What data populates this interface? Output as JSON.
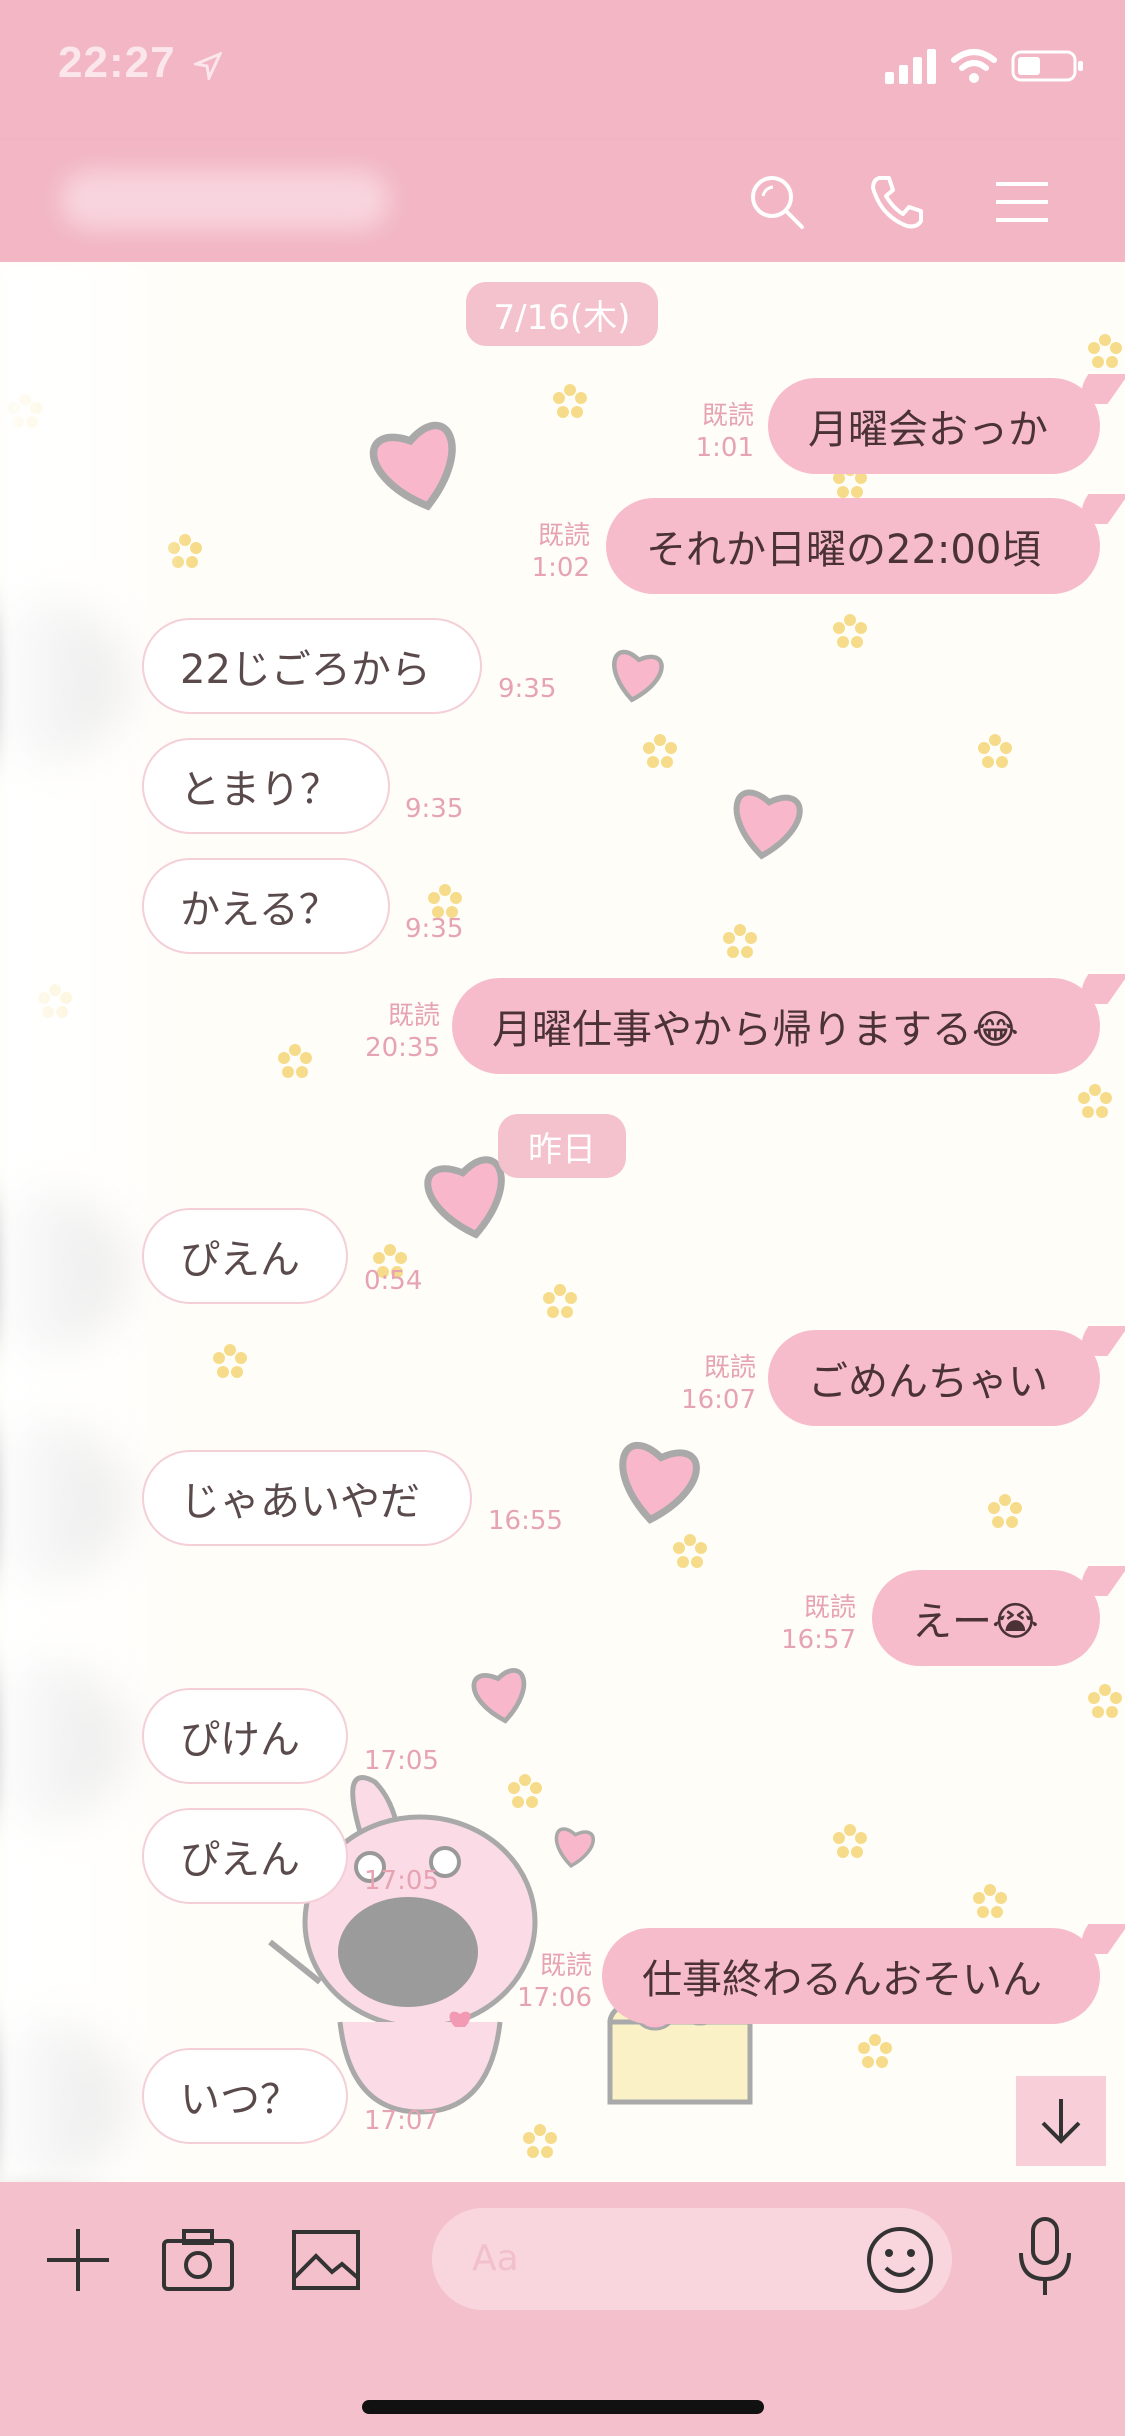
{
  "status_bar": {
    "time": "22:27"
  },
  "header": {
    "title": "さ"
  },
  "colors": {
    "header_bg": "#f2b6c4",
    "outgoing_bubble": "#f7bccb",
    "incoming_bubble": "#ffffff",
    "meta_text": "#e6a3b2",
    "input_bar_bg": "#f4c0cc"
  },
  "icons": {
    "search": "search-icon",
    "call": "phone-icon",
    "menu": "menu-icon",
    "add": "plus-icon",
    "camera": "camera-icon",
    "gallery": "image-icon",
    "emoji": "emoji-icon",
    "mic": "mic-icon",
    "scroll_down": "arrow-down-icon"
  },
  "chat": {
    "dates": [
      "7/16(木)",
      "昨日"
    ],
    "read_label": "既読",
    "messages": [
      {
        "dir": "out",
        "text": "月曜会おっか",
        "time": "1:01",
        "read": true
      },
      {
        "dir": "out",
        "text": "それか日曜の22:00頃",
        "time": "1:02",
        "read": true
      },
      {
        "dir": "in",
        "text": "22じごろから",
        "time": "9:35"
      },
      {
        "dir": "in",
        "text": "とまり？",
        "time": "9:35"
      },
      {
        "dir": "in",
        "text": "かえる？",
        "time": "9:35"
      },
      {
        "dir": "out",
        "text": "月曜仕事やから帰りまする😂",
        "time": "20:35",
        "read": true
      },
      {
        "dir": "in",
        "text": "ぴえん",
        "time": "0:54"
      },
      {
        "dir": "out",
        "text": "ごめんちゃい",
        "time": "16:07",
        "read": true
      },
      {
        "dir": "in",
        "text": "じゃあいやだ",
        "time": "16:55"
      },
      {
        "dir": "out",
        "text": "えー😭",
        "time": "16:57",
        "read": true
      },
      {
        "dir": "in",
        "text": "ぴけん",
        "time": "17:05"
      },
      {
        "dir": "in",
        "text": "ぴえん",
        "time": "17:05"
      },
      {
        "dir": "out",
        "text": "仕事終わるんおそいん",
        "time": "17:06",
        "read": true
      },
      {
        "dir": "in",
        "text": "いつ？",
        "time": "17:07"
      }
    ]
  },
  "input": {
    "placeholder": "Aa"
  }
}
